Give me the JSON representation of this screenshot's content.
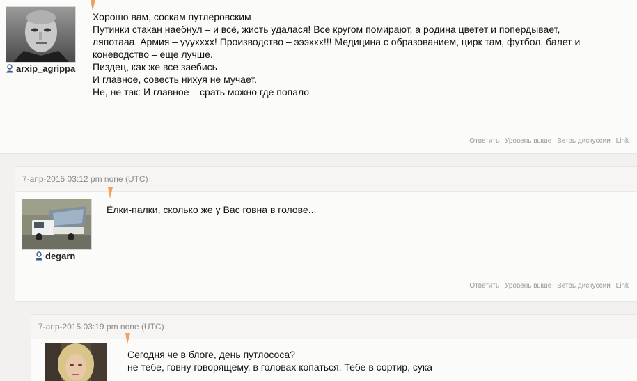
{
  "comments": [
    {
      "username": "arxip_agrippa",
      "avatar_icon": "user-avatar-photo-portrait",
      "text_lines": [
        "Хорошо вам, соскам путлеровским",
        "Путинки стакан наебнул – и всё, жисть удалася! Все кругом помирают, а родина цветет и попердывает,",
        "ляпотааа. Армия – ууухххх! Производство – эээххх!!! Медицина с образованием, цирк там, футбол, балет и",
        "коневодство – еще лучше.",
        "Пиздец, как же все заебись",
        "И главное, совесть нихуя не мучает.",
        "Не, не так: И главное – срать можно где попало"
      ],
      "actions": [
        "Ответить",
        "Уровень выше",
        "Ветвь дискуссии",
        "Link"
      ]
    },
    {
      "timestamp": "7-апр-2015 03:12 pm none (UTC)",
      "username": "degarn",
      "avatar_icon": "user-avatar-photo-truck",
      "text_lines": [
        "Ёлки-палки, сколько же у Вас говна в голове..."
      ],
      "actions": [
        "Ответить",
        "Уровень выше",
        "Ветвь дискуссии",
        "Link"
      ]
    },
    {
      "timestamp": "7-апр-2015 03:19 pm none (UTC)",
      "avatar_icon": "user-avatar-photo-blonde",
      "text_lines": [
        "Сегодня че в блоге, день путлососа?",
        "не тебе, говну говорящему, в головах копаться. Тебе в сортир, сука"
      ]
    }
  ],
  "colors": {
    "accent_tail": "#f0a060",
    "meta_text": "#888888",
    "action_text": "#9a9a9a",
    "user_icon": "#3b5a8a"
  }
}
